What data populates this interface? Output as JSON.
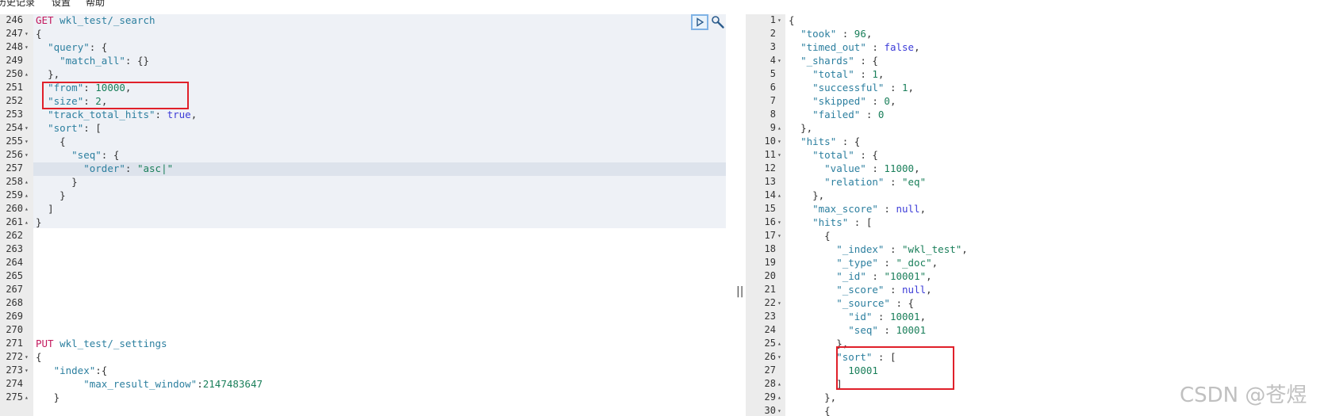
{
  "menu": [
    "历史记录",
    "设置",
    "帮助"
  ],
  "left_lines": [
    {
      "n": "246",
      "fold": "",
      "html": "<span class='m'>GET</span> <span class='u'>wkl_test/_search</span>"
    },
    {
      "n": "247",
      "fold": "▾",
      "html": "<span class='p'>{</span>"
    },
    {
      "n": "248",
      "fold": "▾",
      "html": "  <span class='k'>\"query\"</span><span class='p'>: {</span>"
    },
    {
      "n": "249",
      "fold": "",
      "html": "    <span class='k'>\"match_all\"</span><span class='p'>: {}</span>"
    },
    {
      "n": "250",
      "fold": "▴",
      "html": "  <span class='p'>},</span>"
    },
    {
      "n": "251",
      "fold": "",
      "html": "  <span class='k'>\"from\"</span><span class='p'>: </span><span class='n'>10000</span><span class='p'>,</span>"
    },
    {
      "n": "252",
      "fold": "",
      "html": "  <span class='k'>\"size\"</span><span class='p'>: </span><span class='n'>2</span><span class='p'>,</span>"
    },
    {
      "n": "253",
      "fold": "",
      "html": "  <span class='k'>\"track_total_hits\"</span><span class='p'>: </span><span class='b'>true</span><span class='p'>,</span>"
    },
    {
      "n": "254",
      "fold": "▾",
      "html": "  <span class='k'>\"sort\"</span><span class='p'>: [</span>"
    },
    {
      "n": "255",
      "fold": "▾",
      "html": "    <span class='p'>{</span>"
    },
    {
      "n": "256",
      "fold": "▾",
      "html": "      <span class='k'>\"seq\"</span><span class='p'>: {</span>"
    },
    {
      "n": "257",
      "fold": "",
      "html": "        <span class='k'>\"order\"</span><span class='p'>: </span><span class='s'>\"asc|\"</span>"
    },
    {
      "n": "258",
      "fold": "▴",
      "html": "      <span class='p'>}</span>"
    },
    {
      "n": "259",
      "fold": "▴",
      "html": "    <span class='p'>}</span>"
    },
    {
      "n": "260",
      "fold": "▴",
      "html": "  <span class='p'>]</span>"
    },
    {
      "n": "261",
      "fold": "▴",
      "html": "<span class='p'>}</span>"
    },
    {
      "n": "262",
      "fold": "",
      "html": ""
    },
    {
      "n": "263",
      "fold": "",
      "html": ""
    },
    {
      "n": "264",
      "fold": "",
      "html": ""
    },
    {
      "n": "265",
      "fold": "",
      "html": ""
    },
    {
      "n": "267",
      "fold": "",
      "html": ""
    },
    {
      "n": "268",
      "fold": "",
      "html": ""
    },
    {
      "n": "269",
      "fold": "",
      "html": ""
    },
    {
      "n": "270",
      "fold": "",
      "html": ""
    },
    {
      "n": "271",
      "fold": "",
      "html": "<span class='m'>PUT</span> <span class='u'>wkl_test/_settings</span>"
    },
    {
      "n": "272",
      "fold": "▾",
      "html": "<span class='p'>{</span>"
    },
    {
      "n": "273",
      "fold": "▾",
      "html": "   <span class='k'>\"index\"</span><span class='p'>:{</span>"
    },
    {
      "n": "274",
      "fold": "",
      "html": "        <span class='k'>\"max_result_window\"</span><span class='p'>:</span><span class='n'>2147483647</span>"
    },
    {
      "n": "275",
      "fold": "▴",
      "html": "   <span class='p'>}</span>"
    }
  ],
  "right_lines": [
    {
      "n": "1",
      "fold": "▾",
      "html": "<span class='p'>{</span>"
    },
    {
      "n": "2",
      "fold": "",
      "html": "  <span class='k'>\"took\"</span><span class='p'> : </span><span class='n'>96</span><span class='p'>,</span>"
    },
    {
      "n": "3",
      "fold": "",
      "html": "  <span class='k'>\"timed_out\"</span><span class='p'> : </span><span class='b'>false</span><span class='p'>,</span>"
    },
    {
      "n": "4",
      "fold": "▾",
      "html": "  <span class='k'>\"_shards\"</span><span class='p'> : {</span>"
    },
    {
      "n": "5",
      "fold": "",
      "html": "    <span class='k'>\"total\"</span><span class='p'> : </span><span class='n'>1</span><span class='p'>,</span>"
    },
    {
      "n": "6",
      "fold": "",
      "html": "    <span class='k'>\"successful\"</span><span class='p'> : </span><span class='n'>1</span><span class='p'>,</span>"
    },
    {
      "n": "7",
      "fold": "",
      "html": "    <span class='k'>\"skipped\"</span><span class='p'> : </span><span class='n'>0</span><span class='p'>,</span>"
    },
    {
      "n": "8",
      "fold": "",
      "html": "    <span class='k'>\"failed\"</span><span class='p'> : </span><span class='n'>0</span>"
    },
    {
      "n": "9",
      "fold": "▴",
      "html": "  <span class='p'>},</span>"
    },
    {
      "n": "10",
      "fold": "▾",
      "html": "  <span class='k'>\"hits\"</span><span class='p'> : {</span>"
    },
    {
      "n": "11",
      "fold": "▾",
      "html": "    <span class='k'>\"total\"</span><span class='p'> : {</span>"
    },
    {
      "n": "12",
      "fold": "",
      "html": "      <span class='k'>\"value\"</span><span class='p'> : </span><span class='n'>11000</span><span class='p'>,</span>"
    },
    {
      "n": "13",
      "fold": "",
      "html": "      <span class='k'>\"relation\"</span><span class='p'> : </span><span class='s'>\"eq\"</span>"
    },
    {
      "n": "14",
      "fold": "▴",
      "html": "    <span class='p'>},</span>"
    },
    {
      "n": "15",
      "fold": "",
      "html": "    <span class='k'>\"max_score\"</span><span class='p'> : </span><span class='b'>null</span><span class='p'>,</span>"
    },
    {
      "n": "16",
      "fold": "▾",
      "html": "    <span class='k'>\"hits\"</span><span class='p'> : [</span>"
    },
    {
      "n": "17",
      "fold": "▾",
      "html": "      <span class='p'>{</span>"
    },
    {
      "n": "18",
      "fold": "",
      "html": "        <span class='k'>\"_index\"</span><span class='p'> : </span><span class='s'>\"wkl_test\"</span><span class='p'>,</span>"
    },
    {
      "n": "19",
      "fold": "",
      "html": "        <span class='k'>\"_type\"</span><span class='p'> : </span><span class='s'>\"_doc\"</span><span class='p'>,</span>"
    },
    {
      "n": "20",
      "fold": "",
      "html": "        <span class='k'>\"_id\"</span><span class='p'> : </span><span class='s'>\"10001\"</span><span class='p'>,</span>"
    },
    {
      "n": "21",
      "fold": "",
      "html": "        <span class='k'>\"_score\"</span><span class='p'> : </span><span class='b'>null</span><span class='p'>,</span>"
    },
    {
      "n": "22",
      "fold": "▾",
      "html": "        <span class='k'>\"_source\"</span><span class='p'> : {</span>"
    },
    {
      "n": "23",
      "fold": "",
      "html": "          <span class='k'>\"id\"</span><span class='p'> : </span><span class='n'>10001</span><span class='p'>,</span>"
    },
    {
      "n": "24",
      "fold": "",
      "html": "          <span class='k'>\"seq\"</span><span class='p'> : </span><span class='n'>10001</span>"
    },
    {
      "n": "25",
      "fold": "▴",
      "html": "        <span class='p'>},</span>"
    },
    {
      "n": "26",
      "fold": "▾",
      "html": "        <span class='k'>\"sort\"</span><span class='p'> : [</span>"
    },
    {
      "n": "27",
      "fold": "",
      "html": "          <span class='n'>10001</span>"
    },
    {
      "n": "28",
      "fold": "▴",
      "html": "        <span class='p'>]</span>"
    },
    {
      "n": "29",
      "fold": "▴",
      "html": "      <span class='p'>},</span>"
    },
    {
      "n": "30",
      "fold": "▾",
      "html": "      <span class='p'>{</span>"
    }
  ],
  "watermark": "CSDN @苍煜",
  "divider_glyph": "||"
}
